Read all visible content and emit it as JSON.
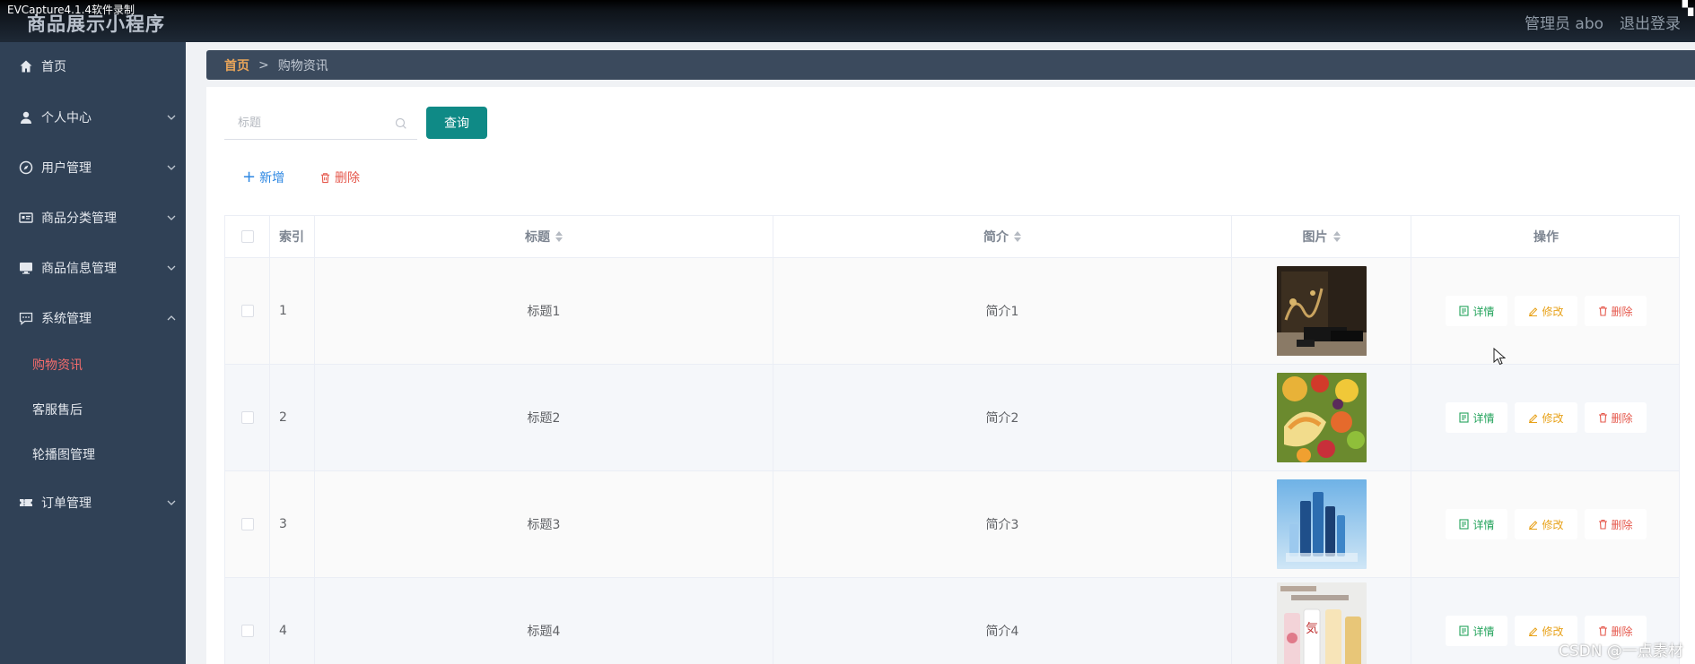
{
  "recorder": {
    "title": "EVCapture4.1.4软件录制"
  },
  "header": {
    "app_title": "商品展示小程序",
    "admin_label": "管理员 abo",
    "logout": "退出登录"
  },
  "sidebar": {
    "items": [
      {
        "label": "首页",
        "icon": "home-icon"
      },
      {
        "label": "个人中心",
        "icon": "user-icon"
      },
      {
        "label": "用户管理",
        "icon": "compass-icon"
      },
      {
        "label": "商品分类管理",
        "icon": "id-card-icon"
      },
      {
        "label": "商品信息管理",
        "icon": "monitor-icon"
      },
      {
        "label": "系统管理",
        "icon": "chat-icon"
      }
    ],
    "sub_items": [
      {
        "label": "购物资讯",
        "active": true
      },
      {
        "label": "客服售后"
      },
      {
        "label": "轮播图管理"
      }
    ],
    "order": {
      "label": "订单管理",
      "icon": "ticket-icon"
    }
  },
  "breadcrumb": {
    "home": "首页",
    "separator": ">",
    "current": "购物资讯"
  },
  "search": {
    "placeholder": "标题",
    "button": "查询"
  },
  "actions": {
    "add": "新增",
    "delete": "删除"
  },
  "table": {
    "headers": {
      "index": "索引",
      "title": "标题",
      "intro": "简介",
      "image": "图片",
      "operation": "操作"
    },
    "rows": [
      {
        "index": "1",
        "title": "标题1",
        "intro": "简介1",
        "image": "black-gift-box-photo"
      },
      {
        "index": "2",
        "title": "标题2",
        "intro": "简介2",
        "image": "fruit-platter-photo"
      },
      {
        "index": "3",
        "title": "标题3",
        "intro": "简介3",
        "image": "blue-cosmetics-photo"
      },
      {
        "index": "4",
        "title": "标题4",
        "intro": "简介4",
        "image": "drink-bottles-photo"
      }
    ],
    "op_labels": {
      "detail": "详情",
      "edit": "修改",
      "delete": "删除"
    }
  },
  "watermark": "CSDN @一点素材",
  "colors": {
    "sidebar": "#304156",
    "accent": "#0f8a86",
    "active_menu": "#f56c6c",
    "breadcrumb_home": "#e9a55a"
  }
}
